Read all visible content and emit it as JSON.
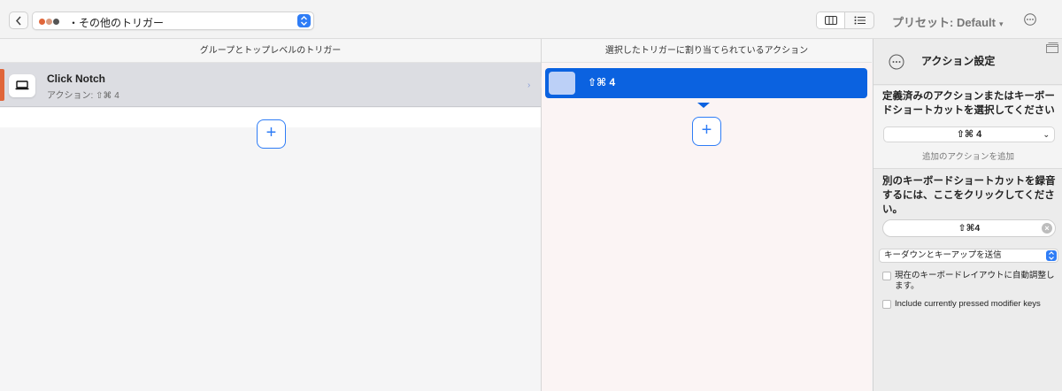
{
  "toolbar": {
    "trigger_category": "・その他のトリガー",
    "preset_label": "プリセット: Default",
    "dots_colors": [
      "#e0663a",
      "#d99a7e",
      "#555555"
    ]
  },
  "left": {
    "header": "グループとトップレベルのトリガー",
    "trigger": {
      "name": "Click Notch",
      "subtitle": "アクション: ⇧⌘ 4"
    },
    "add_label": "+"
  },
  "middle": {
    "header": "選択したトリガーに割り当てられているアクション",
    "action_label": "⇧⌘ 4",
    "add_label": "+"
  },
  "right": {
    "title": "アクション設定",
    "section1_heading": "定義済みのアクションまたはキーボードショートカットを選択してください",
    "selected_action": "⇧⌘ 4",
    "add_action_link": "追加のアクションを追加",
    "section2_heading": "別のキーボードショートカットを録音するには、ここをクリックしてください。",
    "recorded_shortcut": "⇧⌘4",
    "send_mode": "キーダウンとキーアップを送信",
    "checkbox1": "現在のキーボードレイアウトに自動調整します。",
    "checkbox2": "Include currently pressed modifier keys"
  },
  "colors": {
    "accent": "#2f7df6",
    "selected_action": "#0b62e0",
    "trigger_accent": "#e0663a"
  }
}
